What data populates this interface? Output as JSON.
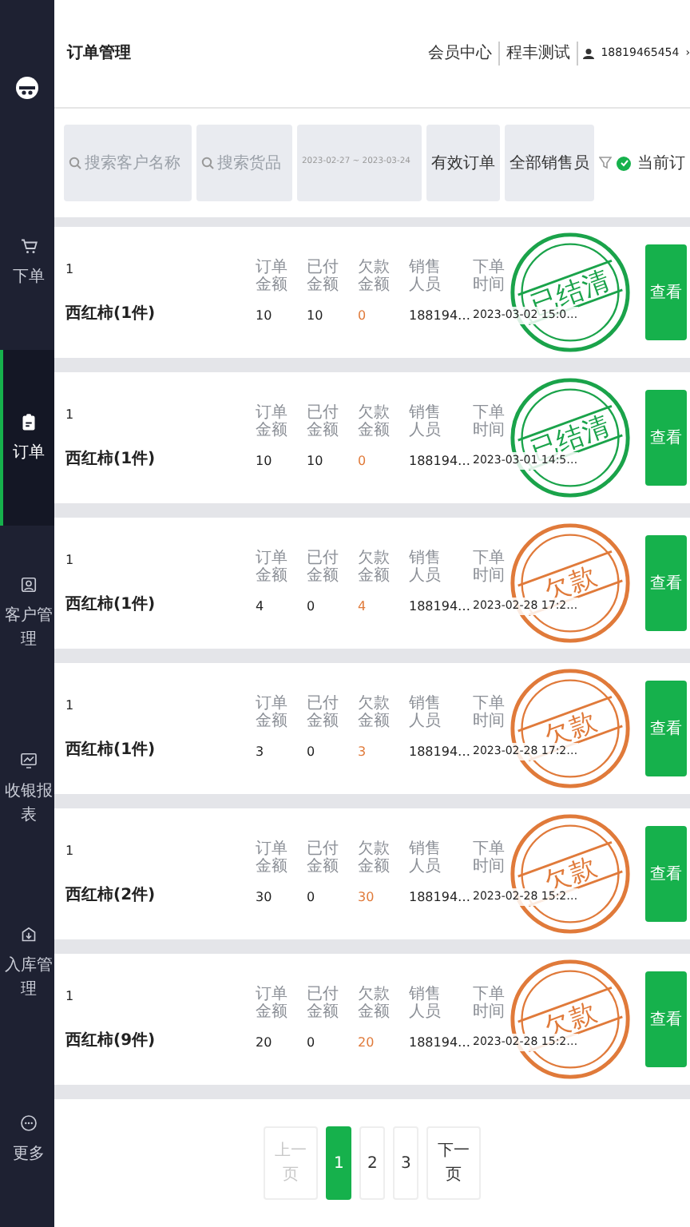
{
  "sidebar": {
    "items": [
      {
        "label": "下单",
        "selected": false
      },
      {
        "label": "订单",
        "selected": true
      },
      {
        "label": "客户管理",
        "selected": false
      },
      {
        "label": "收银报表",
        "selected": false
      },
      {
        "label": "入库管理",
        "selected": false
      },
      {
        "label": "更多",
        "selected": false
      }
    ]
  },
  "header": {
    "title": "订单管理",
    "links": [
      "会员中心",
      "程丰测试"
    ],
    "user": "18819465454",
    "chevron": "›"
  },
  "filters": {
    "customer_search": {
      "placeholder": "搜索客户名称"
    },
    "goods_search": {
      "placeholder": "搜索货品"
    },
    "date_start": "2023-02-27",
    "date_sep": "~",
    "date_end": "2023-03-24",
    "status_select": "有效订单",
    "sales_select": "全部销售员",
    "current_order": {
      "label": "当前订",
      "checked": true
    }
  },
  "orders": [
    {
      "number": "1",
      "items": "西红柿(1件)",
      "labels": [
        "订单金额",
        "已付金额",
        "欠款金额",
        "销售人员",
        "下单时间"
      ],
      "total": "10",
      "paid": "10",
      "owed": "0",
      "sales": "188194…",
      "time": "2023-03-02 15:0…",
      "stamp": {
        "kind": "settled",
        "text": "已结清"
      },
      "button": "查看"
    },
    {
      "number": "1",
      "items": "西红柿(1件)",
      "labels": [
        "订单金额",
        "已付金额",
        "欠款金额",
        "销售人员",
        "下单时间"
      ],
      "total": "10",
      "paid": "10",
      "owed": "0",
      "sales": "188194…",
      "time": "2023-03-01 14:5…",
      "stamp": {
        "kind": "settled",
        "text": "已结清"
      },
      "button": "查看"
    },
    {
      "number": "1",
      "items": "西红柿(1件)",
      "labels": [
        "订单金额",
        "已付金额",
        "欠款金额",
        "销售人员",
        "下单时间"
      ],
      "total": "4",
      "paid": "0",
      "owed": "4",
      "sales": "188194…",
      "time": "2023-02-28 17:2…",
      "stamp": {
        "kind": "owed",
        "text": "欠款"
      },
      "button": "查看"
    },
    {
      "number": "1",
      "items": "西红柿(1件)",
      "labels": [
        "订单金额",
        "已付金额",
        "欠款金额",
        "销售人员",
        "下单时间"
      ],
      "total": "3",
      "paid": "0",
      "owed": "3",
      "sales": "188194…",
      "time": "2023-02-28 17:2…",
      "stamp": {
        "kind": "owed",
        "text": "欠款"
      },
      "button": "查看"
    },
    {
      "number": "1",
      "items": "西红柿(2件)",
      "labels": [
        "订单金额",
        "已付金额",
        "欠款金额",
        "销售人员",
        "下单时间"
      ],
      "total": "30",
      "paid": "0",
      "owed": "30",
      "sales": "188194…",
      "time": "2023-02-28 15:2…",
      "stamp": {
        "kind": "owed",
        "text": "欠款"
      },
      "button": "查看"
    },
    {
      "number": "1",
      "items": "西红柿(9件)",
      "labels": [
        "订单金额",
        "已付金额",
        "欠款金额",
        "销售人员",
        "下单时间"
      ],
      "total": "20",
      "paid": "0",
      "owed": "20",
      "sales": "188194…",
      "time": "2023-02-28 15:2…",
      "stamp": {
        "kind": "owed",
        "text": "欠款"
      },
      "button": "查看"
    }
  ],
  "pagination": [
    {
      "label": "上一页",
      "kind": "prev",
      "disabled": true,
      "selected": false
    },
    {
      "label": "1",
      "kind": "page",
      "disabled": false,
      "selected": true
    },
    {
      "label": "2",
      "kind": "page",
      "disabled": false,
      "selected": false
    },
    {
      "label": "3",
      "kind": "page",
      "disabled": false,
      "selected": false
    },
    {
      "label": "下一页",
      "kind": "next",
      "disabled": false,
      "selected": false
    }
  ]
}
